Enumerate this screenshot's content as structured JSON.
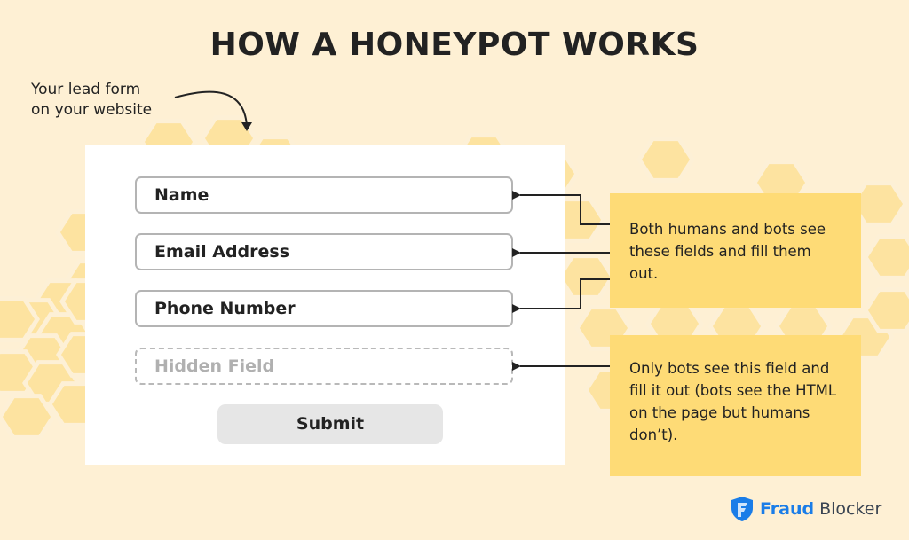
{
  "title": "HOW A HONEYPOT WORKS",
  "form_caption": "Your lead form\non your website",
  "form": {
    "fields": [
      {
        "label": "Name",
        "visible_to": "humans and bots"
      },
      {
        "label": "Email Address",
        "visible_to": "humans and bots"
      },
      {
        "label": "Phone Number",
        "visible_to": "humans and bots"
      },
      {
        "label": "Hidden Field",
        "visible_to": "bots only"
      }
    ],
    "submit_label": "Submit"
  },
  "notes": [
    {
      "text": "Both humans and bots see these fields and fill them out."
    },
    {
      "text": "Only bots see this field and fill it out (bots see the HTML on the page but humans don’t)."
    }
  ],
  "brand": {
    "icon": "shield-f-icon",
    "name_bold": "Fraud",
    "name_regular": "Blocker",
    "color": "#1a7de8"
  },
  "colors": {
    "background": "#fef0d4",
    "honeycomb": "#fde3a0",
    "note_fill": "#fedb76",
    "field_border": "#b4b4b4",
    "submit_fill": "#e6e6e6"
  }
}
